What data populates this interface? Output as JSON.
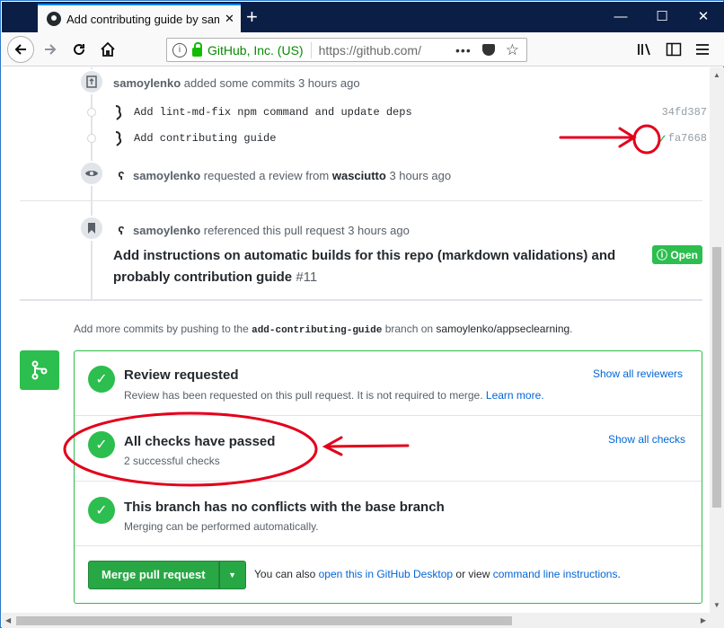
{
  "browser": {
    "tab_title": "Add contributing guide by samoylenko",
    "tab_close": "✕",
    "new_tab": "+",
    "window": {
      "minimize": "—",
      "maximize": "☐",
      "close": "✕"
    },
    "identity": "GitHub, Inc. (US)",
    "url": "https://github.com/",
    "page_actions": "•••"
  },
  "timeline": {
    "commits_header": {
      "author": "samoylenko",
      "text": "added some commits 3 hours ago"
    },
    "commits": [
      {
        "message": "Add lint-md-fix npm command and update deps",
        "sha": "34fd387"
      },
      {
        "message": "Add contributing guide",
        "sha": "fa7668"
      }
    ],
    "review": {
      "author": "samoylenko",
      "text": "requested a review from",
      "reviewer": "wasciutto",
      "time": "3 hours ago"
    },
    "reference": {
      "author": "samoylenko",
      "text": "referenced this pull request 3 hours ago",
      "title": "Add instructions on automatic builds for this repo (markdown validations) and probably contribution guide",
      "number": "#11",
      "state": "Open"
    }
  },
  "hint": {
    "prefix": "Add more commits by pushing to the",
    "branch": "add-contributing-guide",
    "middle": "branch on",
    "repo": "samoylenko/appseclearning",
    "suffix": "."
  },
  "mergebox": {
    "review": {
      "title": "Review requested",
      "desc": "Review has been requested on this pull request. It is not required to merge.",
      "learn_more": "Learn more.",
      "link": "Show all reviewers"
    },
    "checks": {
      "title": "All checks have passed",
      "desc": "2 successful checks",
      "link": "Show all checks"
    },
    "conflicts": {
      "title": "This branch has no conflicts with the base branch",
      "desc": "Merging can be performed automatically."
    },
    "merge_button": "Merge pull request",
    "alt_prefix": "You can also",
    "alt_link1": "open this in GitHub Desktop",
    "alt_middle": "or view",
    "alt_link2": "command line instructions",
    "alt_suffix": "."
  },
  "colors": {
    "success": "#2cbe4e",
    "link": "#0366d6",
    "annotation": "#e3001b",
    "tabstrip": "#0a1e46"
  }
}
